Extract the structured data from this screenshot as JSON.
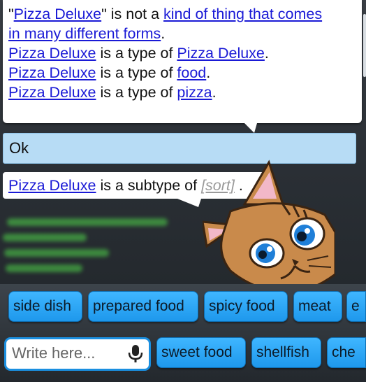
{
  "conversation": {
    "response_lines": [
      {
        "pre": "\"",
        "link1": "Pizza Deluxe",
        "mid": "\" is not a ",
        "link2": "kind of thing that comes",
        "post": ""
      },
      {
        "pre": "",
        "link1": "in many different forms",
        "mid": ".",
        "link2": "",
        "post": ""
      },
      {
        "pre": "",
        "link1": "Pizza Deluxe",
        "mid": " is a type of ",
        "link2": "Pizza Deluxe",
        "post": "."
      },
      {
        "pre": "",
        "link1": "Pizza Deluxe",
        "mid": " is a type of ",
        "link2": "food",
        "post": "."
      },
      {
        "pre": "",
        "link1": "Pizza Deluxe",
        "mid": " is a type of ",
        "link2": "pizza",
        "post": "."
      }
    ],
    "user_reply": "Ok",
    "subtype_line": {
      "link": "Pizza Deluxe",
      "mid": " is a subtype of ",
      "sort_label": "[sort]",
      "post": " ."
    }
  },
  "suggestions_row1": [
    "side dish",
    "prepared food",
    "spicy food",
    "meat",
    "e"
  ],
  "suggestions_row2": [
    "sweet food",
    "shellfish",
    "che"
  ],
  "input": {
    "placeholder": "Write here...",
    "value": ""
  },
  "icons": {
    "mic": "microphone-icon",
    "avatar": "cat-avatar"
  },
  "colors": {
    "link": "#1a1ad6",
    "chip": "#2aa7f7",
    "ok_bar": "#b7dcf5"
  }
}
